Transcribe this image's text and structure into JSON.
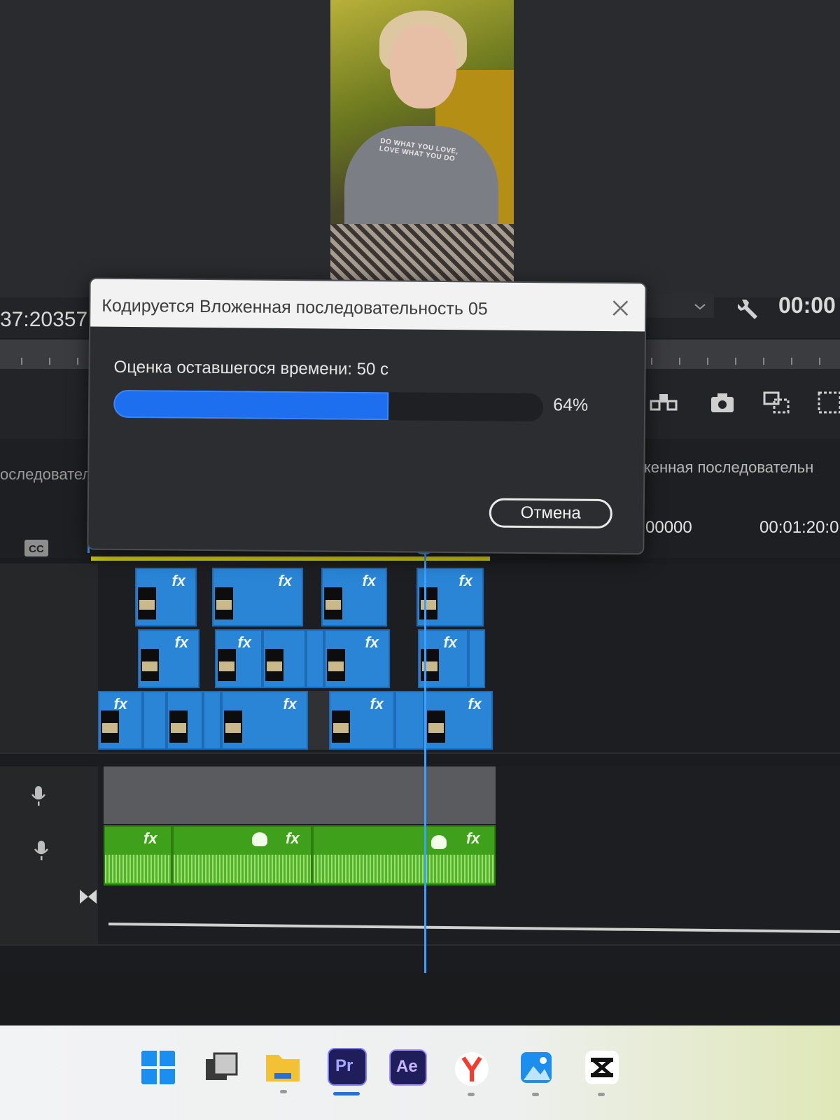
{
  "program_monitor": {
    "left_timecode": "37:20357",
    "right_timecode": "00:00",
    "shirt_text": "DO WHAT YOU LOVE, LOVE WHAT YOU DO"
  },
  "timeline": {
    "sequence_tab_left": "оследовател",
    "sequence_tab_right": "женная последовательн",
    "time_label_1": "00000",
    "time_label_2": "00:01:20:0",
    "cc_label": "CC",
    "fx_label": "fx"
  },
  "dialog": {
    "title": "Кодируется Вложенная последовательность 05",
    "eta_label": "Оценка оставшегося времени: 50 с",
    "progress_percent_text": "64%",
    "progress_value": 0.64,
    "cancel_label": "Отмена"
  },
  "taskbar": {
    "apps": [
      {
        "name": "start-icon"
      },
      {
        "name": "task-view-icon"
      },
      {
        "name": "file-explorer-icon"
      },
      {
        "name": "premiere-pro-icon",
        "label": "Pr",
        "active": true
      },
      {
        "name": "after-effects-icon",
        "label": "Ae"
      },
      {
        "name": "yandex-browser-icon"
      },
      {
        "name": "photos-icon"
      },
      {
        "name": "capcut-icon"
      }
    ]
  },
  "colors": {
    "video_clip": "#2a85d6",
    "audio_clip": "#3fa11b",
    "playhead": "#3aa0ff",
    "progress": "#1e6ff0",
    "work_area": "#d8d416"
  }
}
